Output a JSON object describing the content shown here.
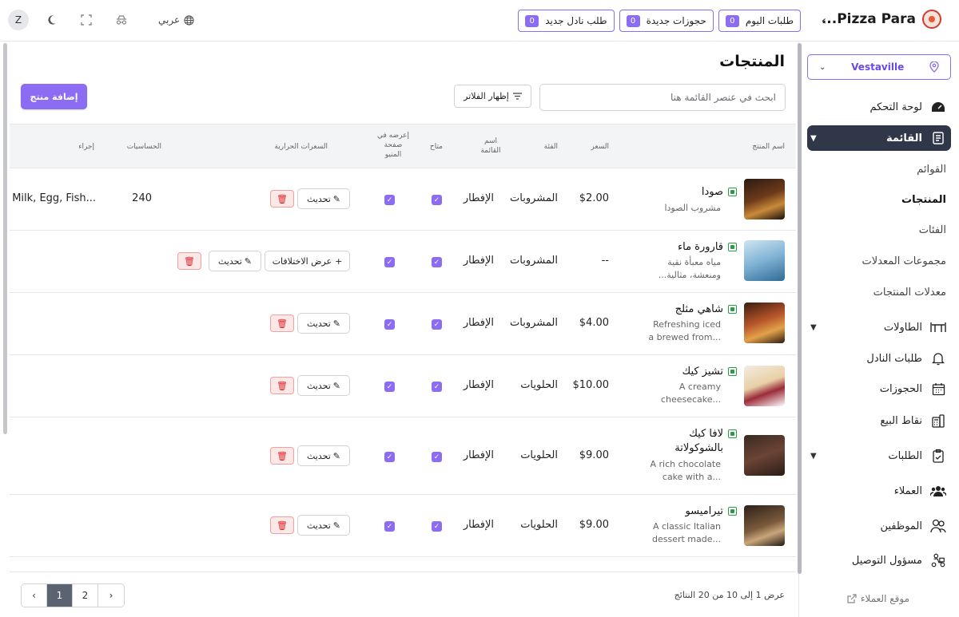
{
  "brand": {
    "name": "Pizza Para..."
  },
  "top_chips": [
    {
      "label": "طلبات اليوم",
      "count": "0"
    },
    {
      "label": "حجوزات جديدة",
      "count": "0"
    },
    {
      "label": "طلب نادل جديد",
      "count": "0"
    }
  ],
  "top_left": {
    "avatar": "Z",
    "lang": "عربي"
  },
  "sidebar": {
    "location": "Vestaville",
    "nav": {
      "dashboard": "لوحة التحكم",
      "menu": "القائمة",
      "tables": "الطاولات",
      "waiter": "طلبات النادل",
      "reservations": "الحجوزات",
      "pos": "نقاط البيع",
      "orders": "الطلبات",
      "customers": "العملاء",
      "staff": "الموظفين",
      "delivery": "مسؤول التوصيل"
    },
    "sub": {
      "menus": "القوائم",
      "products": "المنتجات",
      "categories": "الفئات",
      "modifier_groups": "مجموعات المعدلات",
      "product_modifiers": "معدلات المنتجات"
    },
    "site_link": "موقع العملاء"
  },
  "main": {
    "title": "المنتجات",
    "add_button": "إضافة منتج",
    "filter_button": "إظهار الفلاتر",
    "search_placeholder": "ابحث في عنصر القائمة هنا",
    "headers": {
      "name": "اسم المنتج",
      "price": "السعر",
      "category": "الفئة",
      "menu": "اسم القائمة",
      "available": "متاح",
      "show_on_menu": "إعرضه في صفحة المنيو",
      "calories": "السعرات الحرارية",
      "allergens": "الحساسيات",
      "action": "إجراء"
    },
    "update_label": "تحديث",
    "variations_label": "عرض الاختلافات",
    "rows": [
      {
        "name": "صودا",
        "desc": "مشروب الصودا",
        "price": "$2.00",
        "category": "المشروبات",
        "menu": "الإفطار",
        "calories": "240",
        "allergens": "Milk, Egg, Fish..."
      },
      {
        "name": "قارورة ماء",
        "desc": "مياه معبأة نقية ومنعشة، مثالية...",
        "price": "--",
        "category": "المشروبات",
        "menu": "الإفطار",
        "calories": "",
        "allergens": ""
      },
      {
        "name": "شاهي مثلج",
        "desc": "Refreshing iced a brewed from...",
        "price": "$4.00",
        "category": "المشروبات",
        "menu": "الإفطار",
        "calories": "",
        "allergens": ""
      },
      {
        "name": "تشيز كيك",
        "desc": "A creamy cheesecake...",
        "price": "$10.00",
        "category": "الحلويات",
        "menu": "الإفطار",
        "calories": "",
        "allergens": ""
      },
      {
        "name": "لافا كيك بالشوكولاتة",
        "desc": "A rich chocolate cake with a...",
        "price": "$9.00",
        "category": "الحلويات",
        "menu": "الإفطار",
        "calories": "",
        "allergens": ""
      },
      {
        "name": "تيراميسو",
        "desc": "A classic Italian dessert made...",
        "price": "$9.00",
        "category": "الحلويات",
        "menu": "الإفطار",
        "calories": "",
        "allergens": ""
      }
    ],
    "showing": "عرض 1 إلى 10 من 20 النتائج",
    "pages": [
      "1",
      "2"
    ]
  }
}
